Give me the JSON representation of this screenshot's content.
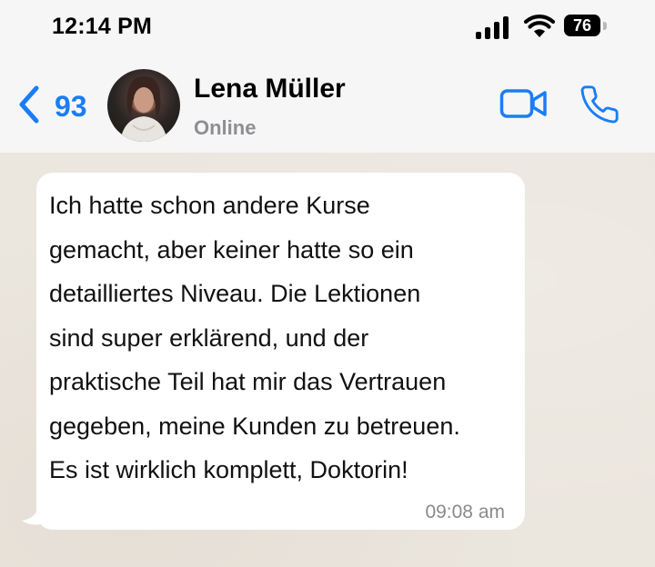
{
  "status_bar": {
    "time": "12:14 PM",
    "battery": "76",
    "icons": [
      "signal-icon",
      "wifi-icon",
      "battery-icon"
    ]
  },
  "header": {
    "back_count": "93",
    "contact_name": "Lena Müller",
    "contact_status": "Online",
    "icons": [
      "chevron-left-icon",
      "video-icon",
      "phone-icon"
    ],
    "accent_color": "#1a7df5"
  },
  "message": {
    "text": " Ich hatte schon andere Kurse\ngemacht, aber keiner hatte so ein\ndetailliertes Niveau. Die Lektionen\nsind super erklärend, und der\npraktische Teil hat mir das Vertrauen\ngegeben, meine Kunden zu betreuen.\nEs ist wirklich komplett, Doktorin!",
    "time": "09:08 am"
  }
}
